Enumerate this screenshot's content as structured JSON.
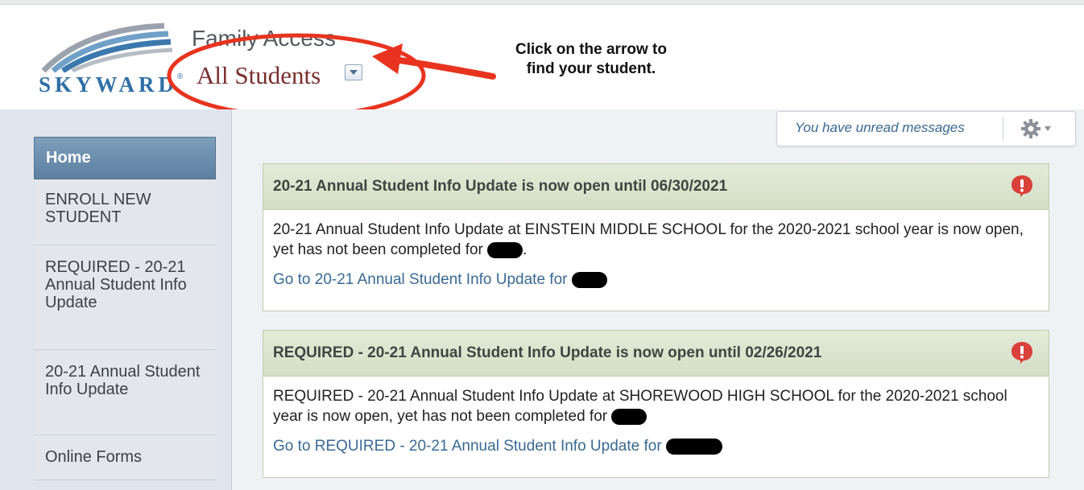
{
  "header": {
    "brand": "SKYWARD",
    "app_title": "Family Access",
    "student_selector": "All Students"
  },
  "annotation": {
    "line1": "Click on the arrow to",
    "line2": "find your student."
  },
  "sidebar": {
    "items": [
      {
        "label": "Home"
      },
      {
        "label": "ENROLL NEW STUDENT"
      },
      {
        "label": "REQUIRED - 20-21 Annual Student Info Update"
      },
      {
        "label": "20-21 Annual Student Info Update"
      },
      {
        "label": "Online Forms"
      }
    ]
  },
  "toolbar": {
    "messages_link": "You have unread messages"
  },
  "notifications": [
    {
      "title": "20-21 Annual Student Info Update is now open until 06/30/2021",
      "body": "20-21 Annual Student Info Update at EINSTEIN MIDDLE SCHOOL for the 2020-2021 school year is now open, yet has not been completed for",
      "link": "Go to 20-21 Annual Student Info Update for"
    },
    {
      "title": "REQUIRED - 20-21 Annual Student Info Update is now open until 02/26/2021",
      "body": "REQUIRED - 20-21 Annual Student Info Update at SHOREWOOD HIGH SCHOOL for the 2020-2021 school year is now open, yet has not been completed for",
      "link": "Go to REQUIRED - 20-21 Annual Student Info Update for"
    }
  ],
  "colors": {
    "brand_blue": "#2f6fa6",
    "nav_active": "#5d80a1",
    "alert_red": "#d9413a",
    "annotation_red": "#e8341f",
    "link_blue": "#3a6994"
  },
  "icons": [
    "gear-icon",
    "chevron-down-icon",
    "alert-icon",
    "dropdown-arrow-icon"
  ]
}
